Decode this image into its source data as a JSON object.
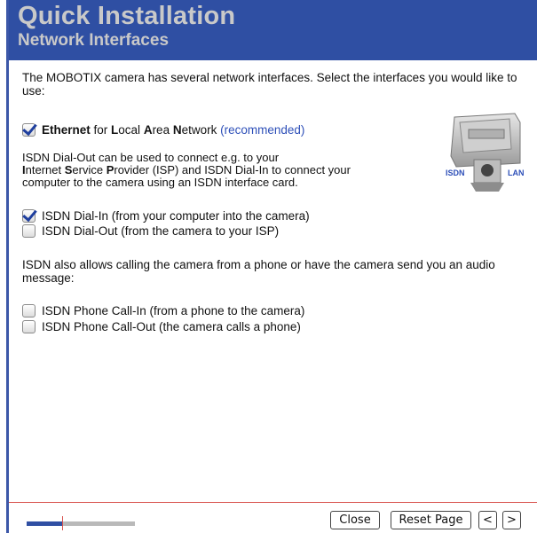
{
  "header": {
    "title": "Quick Installation",
    "subtitle": "Network Interfaces"
  },
  "intro": "The MOBOTIX camera has several network interfaces. Select the interfaces you would like to use:",
  "ethernet": {
    "checked": true,
    "label_parts": [
      "Ethernet",
      " for ",
      "L",
      "ocal ",
      "A",
      "rea ",
      "N",
      "etwork "
    ],
    "recommended": "(recommended)"
  },
  "isdn_description_parts": [
    "ISDN Dial-Out can be used to connect e.g. to your",
    "I",
    "nternet ",
    "S",
    "ervice ",
    "P",
    "rovider (ISP) and ISDN Dial-In to connect your",
    "computer to the camera using an ISDN interface card."
  ],
  "options_group1": [
    {
      "label": "ISDN Dial-In (from your computer into the camera)",
      "checked": true
    },
    {
      "label": "ISDN Dial-Out (from the camera to your ISP)",
      "checked": false
    }
  ],
  "phone_intro": "ISDN also allows calling the camera from a phone or have the camera send you an audio message:",
  "options_group2": [
    {
      "label": "ISDN Phone Call-In (from a phone to the camera)",
      "checked": false
    },
    {
      "label": "ISDN Phone Call-Out (the camera calls a phone)",
      "checked": false
    }
  ],
  "camera_image": {
    "isdn_label": "ISDN",
    "lan_label": "LAN"
  },
  "footer": {
    "progress_fraction": 0.33,
    "close_label": "Close",
    "reset_label": "Reset Page",
    "prev_label": "<",
    "next_label": ">"
  },
  "colors": {
    "header_bg": "#2f4fa3",
    "header_text": "#c9c9c9",
    "accent_link": "#2d4fb8",
    "footer_line": "#d9534f"
  }
}
